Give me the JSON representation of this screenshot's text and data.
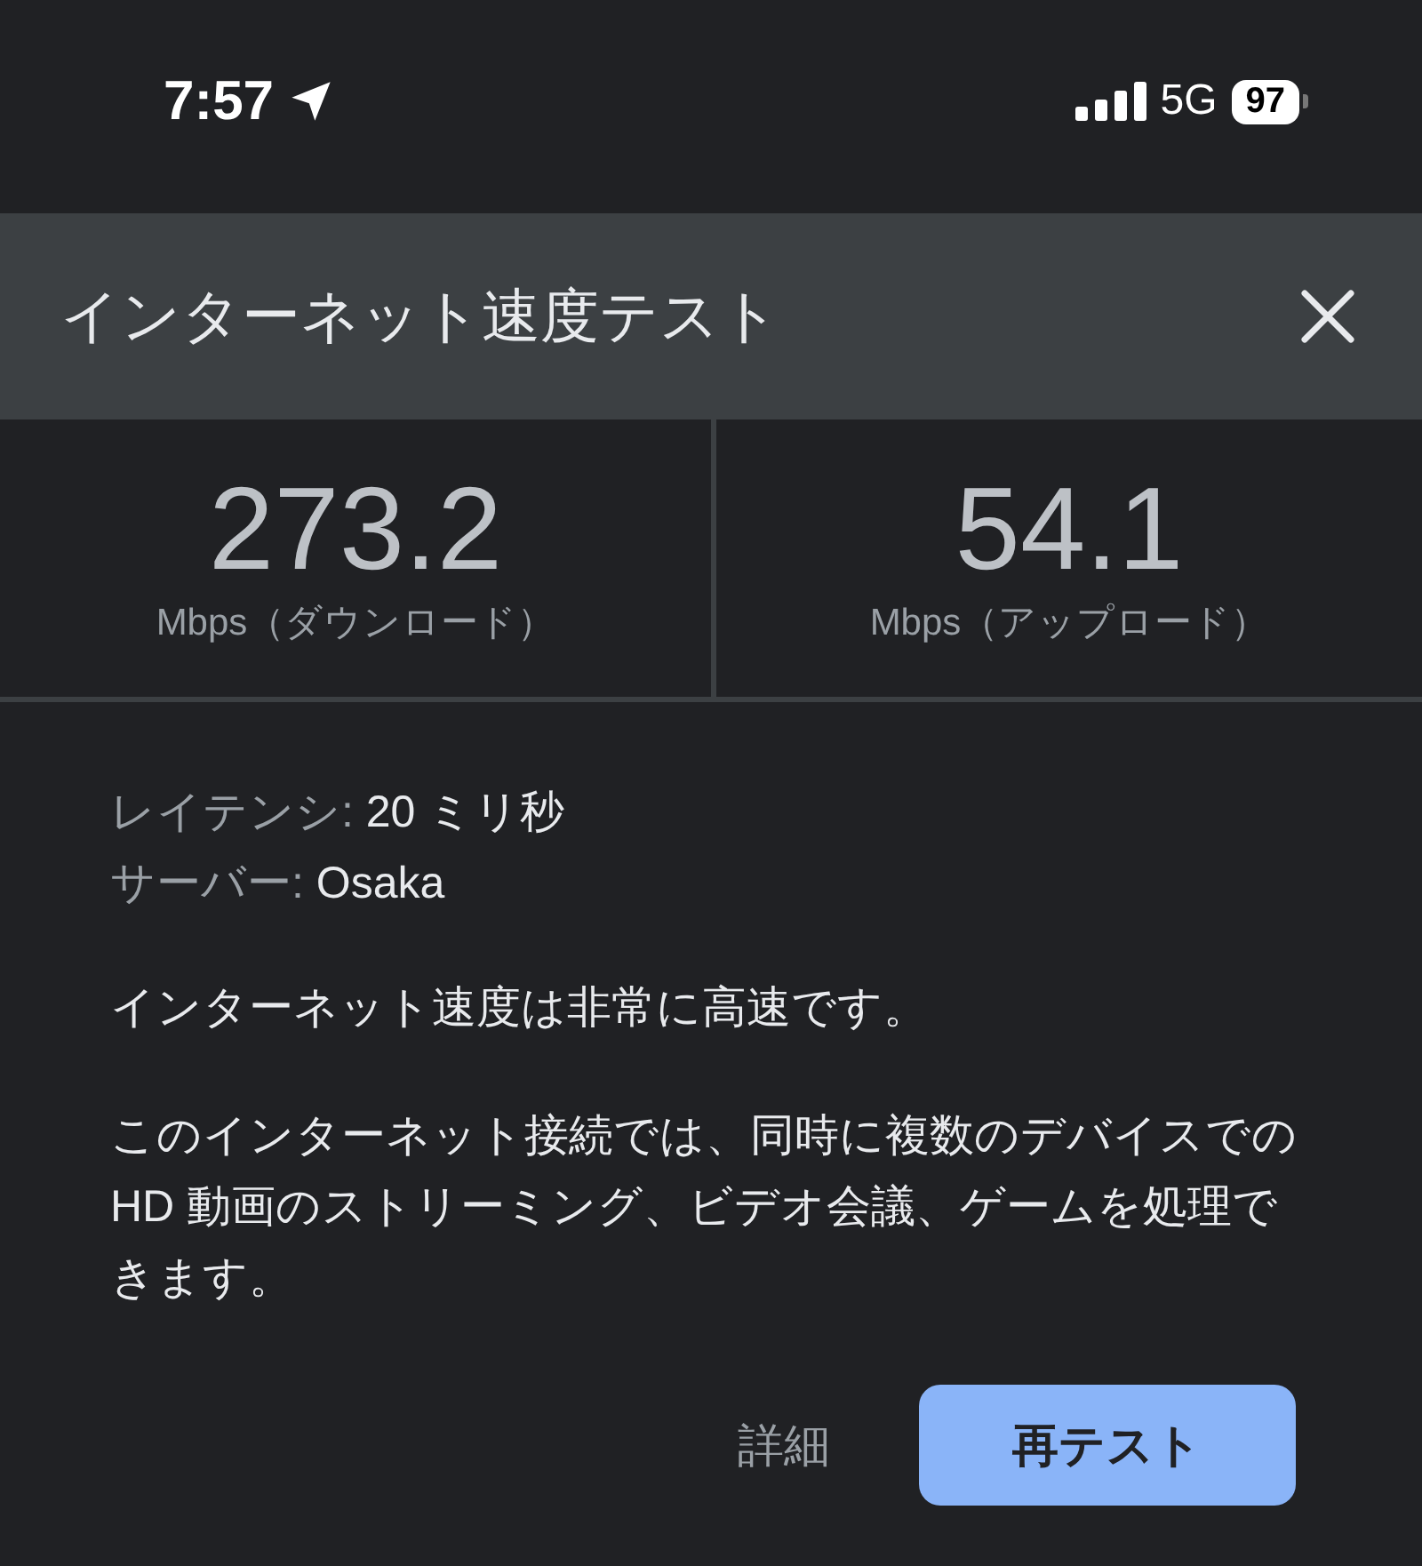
{
  "status_bar": {
    "time": "7:57",
    "network": "5G",
    "battery": "97"
  },
  "header": {
    "title": "インターネット速度テスト"
  },
  "results": [
    {
      "value": "273.2",
      "unit": "Mbps（ダウンロード）"
    },
    {
      "value": "54.1",
      "unit": "Mbps（アップロード）"
    }
  ],
  "details": [
    {
      "label": "レイテンシ:",
      "value": "20 ミリ秒"
    },
    {
      "label": "サーバー:",
      "value": "Osaka"
    }
  ],
  "summary": "インターネット速度は非常に高速です。",
  "description": "このインターネット接続では、同時に複数のデバイスでの HD 動画のストリーミング、ビデオ会議、ゲームを処理できます。",
  "buttons": [
    {
      "label": "詳細",
      "kind": "text"
    },
    {
      "label": "再テスト",
      "kind": "filled"
    }
  ]
}
